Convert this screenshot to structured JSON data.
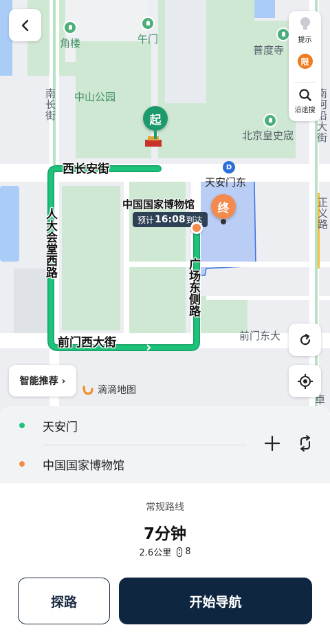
{
  "map": {
    "labels": {
      "jiaolou": "角楼",
      "wumen": "午门",
      "pudusi": "普度寺",
      "zhongshan_park": "中山公园",
      "nanchang_street": "南长街",
      "nanheyan_street": "南河沿大街",
      "huangshi_museum": "北京皇史宬",
      "tiananmen_east": "天安门东",
      "zhengyi_road": "正义路",
      "qianmen_east": "前门东大",
      "zhuo": "卓"
    },
    "roads": {
      "west_changan": "西长安街",
      "renda_west": "人大会堂西路",
      "square_east": "广场东侧路",
      "qianmen_west": "前门西大街"
    },
    "start_marker": "起",
    "end_marker": "终",
    "destination_label": "中国国家博物馆",
    "eta": {
      "prefix": "预计",
      "time": "16:08",
      "suffix": "到达"
    },
    "controls": {
      "hint_label": "提示",
      "restrict_badge": "限",
      "search_along_label": "沿途搜",
      "smart_recommend_label": "智能推荐 ›"
    },
    "brand": "滴滴地图",
    "colors": {
      "route": "#1ec27a",
      "start": "#1d9a6c",
      "end": "#f48a4d",
      "water": "#a9cdf6",
      "park": "#cfe8d3",
      "destination_area": "#b9cdf5"
    },
    "icons": [
      "back-icon",
      "bulb-icon",
      "search-icon",
      "refresh-icon",
      "locate-icon",
      "metro-icon"
    ]
  },
  "route_card": {
    "origin": "天安门",
    "destination": "中国国家博物馆",
    "origin_color": "#1ec27a",
    "destination_color": "#f48a4d"
  },
  "summary": {
    "route_type": "常规路线",
    "duration": "7分钟",
    "distance": "2.6公里",
    "traffic_lights": "8"
  },
  "actions": {
    "explore": "探路",
    "start_navigation": "开始导航"
  }
}
